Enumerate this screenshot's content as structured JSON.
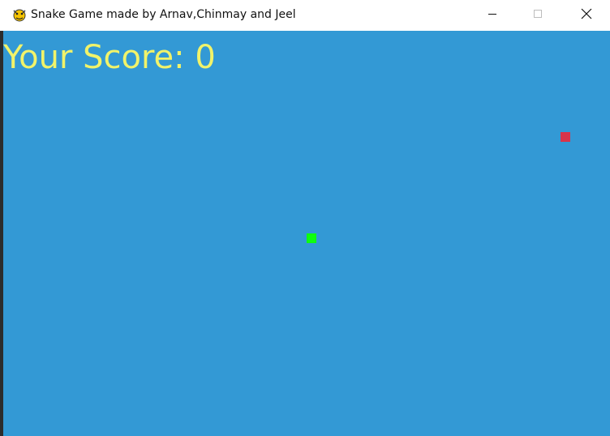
{
  "window": {
    "title": "Snake Game made by Arnav,Chinmay and Jeel",
    "icon": "pygame-snake-icon",
    "controls": [
      "minimize-icon",
      "maximize-icon",
      "close-icon"
    ]
  },
  "game": {
    "background_color": "#3399d5",
    "score_text": "Your Score: 0",
    "score_color": "#f1f36a",
    "food_color": "#d9344a",
    "snake_color": "#0fff0f"
  }
}
